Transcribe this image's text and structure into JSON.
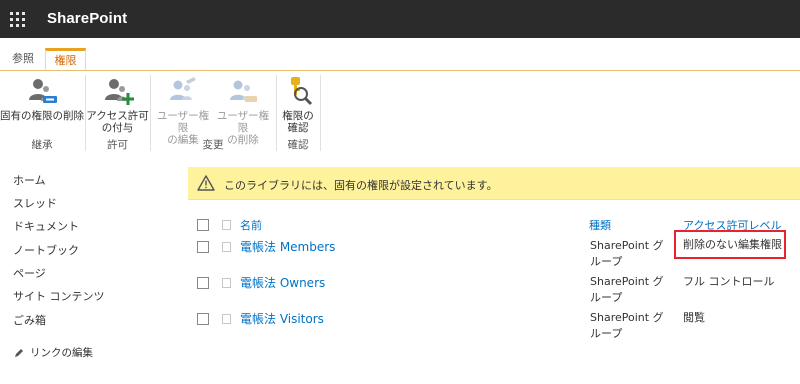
{
  "suitebar": {
    "brand": "SharePoint"
  },
  "ribbon": {
    "tabs": [
      {
        "label": "参照"
      },
      {
        "label": "権限"
      }
    ],
    "buttons": {
      "stop_inheriting": "固有の権限の削除",
      "grant": "アクセス許可\nの付与",
      "edit_user": "ユーザー権限\nの編集",
      "remove_user": "ユーザー権限\nの削除",
      "check": "権限の\n確認"
    },
    "groups": {
      "inheritance": "継承",
      "grant": "許可",
      "modify": "変更",
      "check": "確認"
    }
  },
  "leftnav": {
    "items": [
      "ホーム",
      "スレッド",
      "ドキュメント",
      "ノートブック",
      "ページ",
      "サイト コンテンツ",
      "ごみ箱"
    ],
    "edit_links": "リンクの編集"
  },
  "status": {
    "message": "このライブラリには、固有の権限が設定されています。"
  },
  "list": {
    "headers": {
      "name": "名前",
      "type": "種類",
      "permission": "アクセス許可レベル"
    },
    "rows": [
      {
        "name": "電帳法 Members",
        "type_line1": "SharePoint グ",
        "type_line2": "ループ",
        "permission": "削除のない編集権限"
      },
      {
        "name": "電帳法 Owners",
        "type_line1": "SharePoint グ",
        "type_line2": "ループ",
        "permission": "フル コントロール"
      },
      {
        "name": "電帳法 Visitors",
        "type_line1": "SharePoint グ",
        "type_line2": "ループ",
        "permission": "閲覧"
      }
    ]
  },
  "colors": {
    "accent_link": "#0072c6",
    "tab_accent": "#d26700",
    "status_bg": "#fff29c",
    "highlight": "#e8232f",
    "suitebar": "#2b2b2b"
  }
}
